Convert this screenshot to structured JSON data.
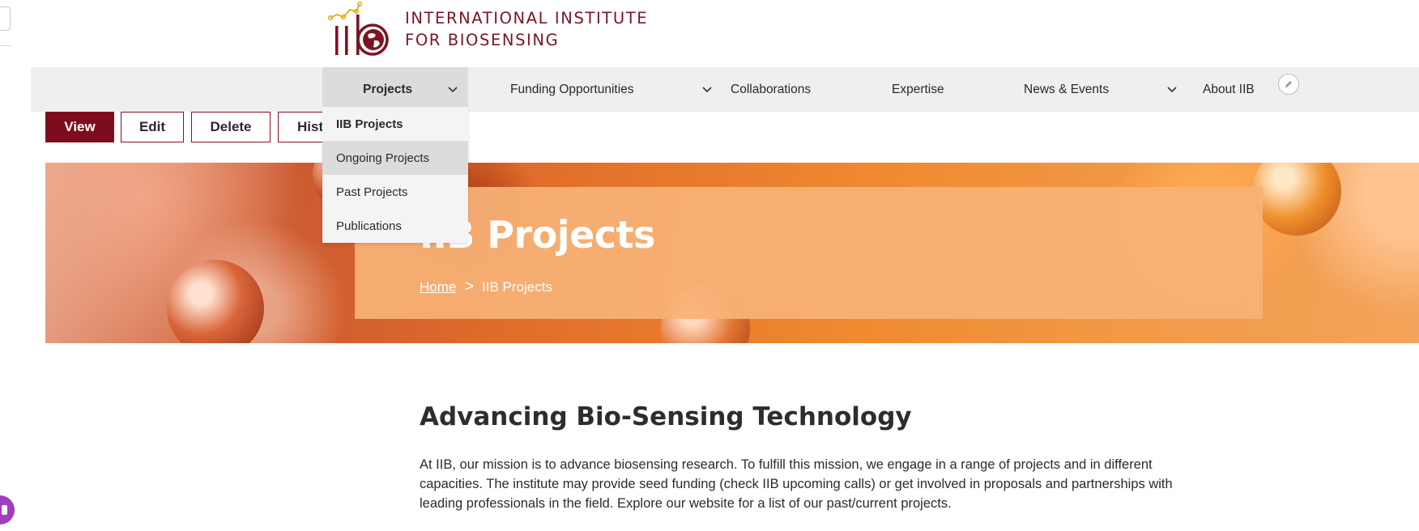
{
  "header": {
    "logo_mark": "IIB",
    "logo_line1": "INTERNATIONAL INSTITUTE",
    "logo_line2": "FOR BIOSENSING"
  },
  "nav": {
    "items": [
      {
        "label": "Projects",
        "has_dropdown": true,
        "active": true
      },
      {
        "label": "Funding Opportunities",
        "has_dropdown": true
      },
      {
        "label": "Collaborations"
      },
      {
        "label": "Expertise"
      },
      {
        "label": "News & Events",
        "has_dropdown": true
      },
      {
        "label": "About IIB"
      }
    ],
    "edit_icon": "pencil-icon"
  },
  "dropdown": {
    "items": [
      {
        "label": "IIB Projects",
        "bold": true
      },
      {
        "label": "Ongoing Projects",
        "hover": true
      },
      {
        "label": "Past Projects"
      },
      {
        "label": "Publications"
      }
    ]
  },
  "actions": {
    "view": "View",
    "edit": "Edit",
    "delete": "Delete",
    "history": "Hist"
  },
  "hero": {
    "title": "IIB Projects",
    "breadcrumb": {
      "home": "Home",
      "separator": ">",
      "current": "IIB Projects"
    }
  },
  "content": {
    "heading": "Advancing Bio-Sensing Technology",
    "paragraph": "At IIB, our mission is to advance biosensing research. To fulfill this mission, we engage in a range of projects and in different capacities. The institute may provide seed funding (check IIB upcoming calls) or get involved in proposals and partnerships with leading professionals in the field. Explore our website for a list of our past/current projects."
  },
  "colors": {
    "brand": "#7b1524",
    "button_primary": "#7e0c1e",
    "nav_bg": "#efefef",
    "hero_panel": "#f7b276"
  }
}
